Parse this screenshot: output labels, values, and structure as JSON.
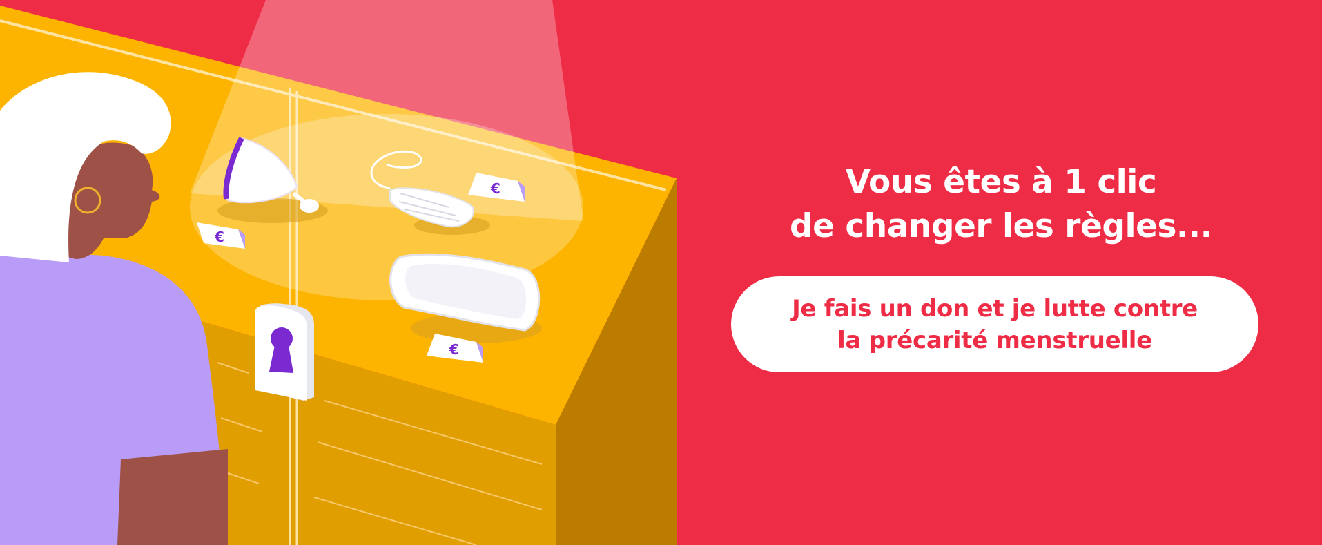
{
  "headline": {
    "line1": "Vous êtes à 1 clic",
    "line2": "de changer les règles..."
  },
  "cta": {
    "line1": "Je fais un don et je lutte contre",
    "line2": "la précarité menstruelle"
  },
  "price_tag_symbol": "€",
  "colors": {
    "background": "#ee2c46",
    "cabinet_top": "#fdb400",
    "cabinet_front": "#e19e00",
    "cabinet_side": "#bb7c00",
    "accent_purple": "#7a2ad0",
    "shirt": "#b99cf7",
    "skin": "#9e5247",
    "button_bg": "#ffffff",
    "button_text": "#ee2c46"
  },
  "icons": [
    "menstrual-cup-icon",
    "tampon-icon",
    "sanitary-pad-icon",
    "euro-tag-icon",
    "keyhole-icon"
  ]
}
